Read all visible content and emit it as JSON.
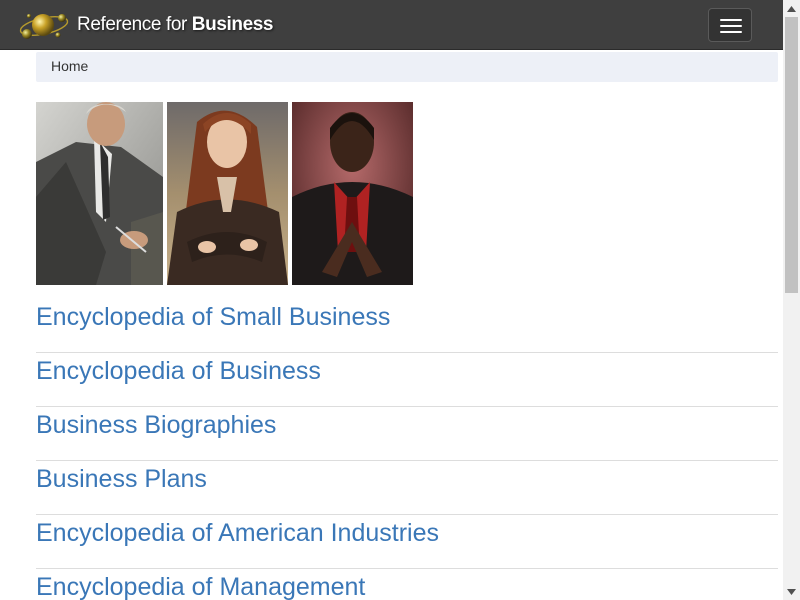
{
  "navbar": {
    "brand_prefix": "Reference for ",
    "brand_bold": "Business",
    "logo_icon": "golden-spheres-logo",
    "menu_icon": "hamburger-menu-icon",
    "background": "#3f3f3f"
  },
  "breadcrumb": {
    "home": "Home"
  },
  "hero": {
    "photos": [
      "businessman-writing-photo",
      "businesswoman-arms-crossed-photo",
      "businessman-steepled-hands-photo"
    ]
  },
  "links": [
    {
      "label": "Encyclopedia of Small Business"
    },
    {
      "label": "Encyclopedia of Business"
    },
    {
      "label": "Business Biographies"
    },
    {
      "label": "Business Plans"
    },
    {
      "label": "Encyclopedia of American Industries"
    },
    {
      "label": "Encyclopedia of Management"
    }
  ],
  "colors": {
    "link": "#3a77b7",
    "breadcrumb_bg": "#edf0f7",
    "divider": "#dddddd"
  }
}
